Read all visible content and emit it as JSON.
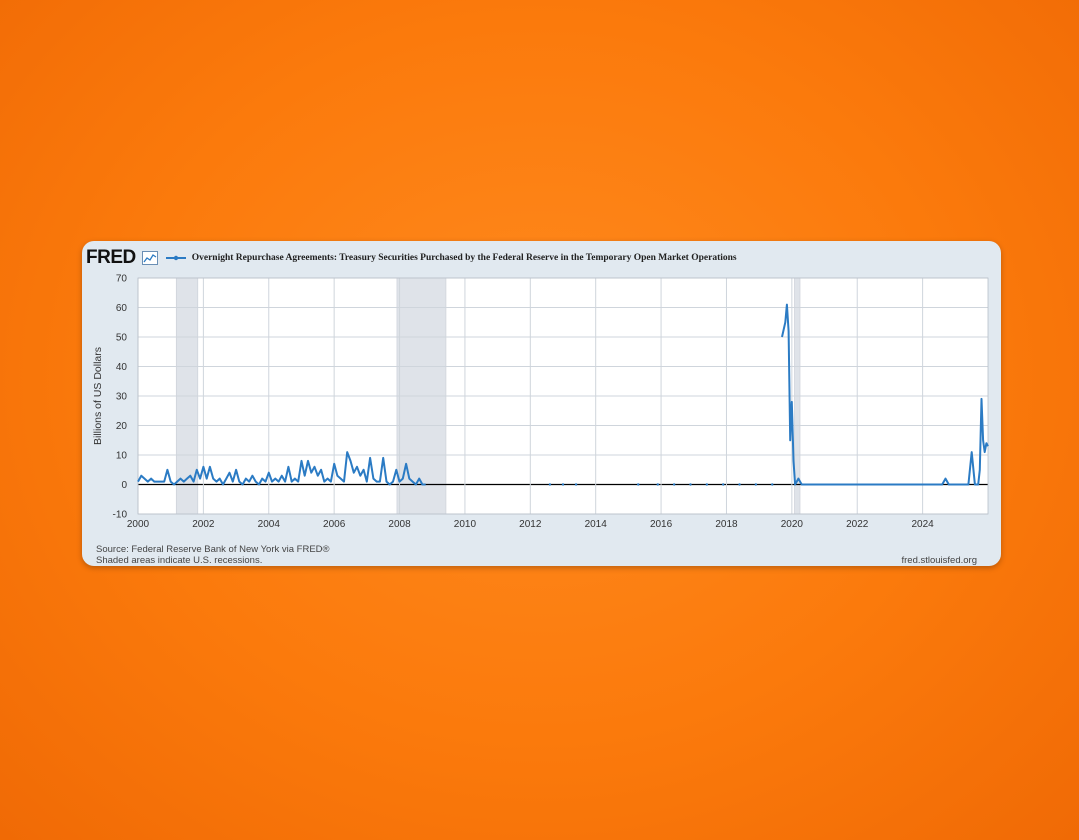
{
  "brand": {
    "logo_text": "FRED"
  },
  "colors": {
    "background": "#fb7a0c",
    "card": "#e1e9f0",
    "line": "#2b7bc4",
    "recession": "#dfe3e9"
  },
  "chart_data": {
    "type": "line",
    "title": "Overnight Repurchase Agreements: Treasury Securities Purchased by the Federal Reserve in the Temporary Open Market Operations",
    "ylabel": "Billions of US Dollars",
    "xlim": [
      2000,
      2026
    ],
    "ylim": [
      -10,
      70
    ],
    "yticks": [
      -10,
      0,
      10,
      20,
      30,
      40,
      50,
      60,
      70
    ],
    "xticks": [
      2000,
      2002,
      2004,
      2006,
      2008,
      2010,
      2012,
      2014,
      2016,
      2018,
      2020,
      2022,
      2024
    ],
    "recessions": [
      [
        2001.17,
        2001.83
      ],
      [
        2007.92,
        2009.42
      ],
      [
        2020.08,
        2020.25
      ]
    ],
    "series": [
      {
        "segments": [
          [
            [
              2000.0,
              1
            ],
            [
              2000.1,
              3
            ],
            [
              2000.2,
              2
            ],
            [
              2000.3,
              1
            ],
            [
              2000.4,
              2
            ],
            [
              2000.5,
              1
            ],
            [
              2000.6,
              1
            ],
            [
              2000.7,
              1
            ],
            [
              2000.8,
              1
            ],
            [
              2000.9,
              5
            ],
            [
              2001.0,
              1
            ],
            [
              2001.1,
              0
            ],
            [
              2001.2,
              1
            ],
            [
              2001.3,
              2
            ],
            [
              2001.4,
              1
            ],
            [
              2001.5,
              2
            ],
            [
              2001.6,
              3
            ],
            [
              2001.7,
              1
            ],
            [
              2001.8,
              5
            ],
            [
              2001.9,
              2
            ],
            [
              2002.0,
              6
            ],
            [
              2002.1,
              2
            ],
            [
              2002.2,
              6
            ],
            [
              2002.3,
              2
            ],
            [
              2002.4,
              1
            ],
            [
              2002.5,
              2
            ],
            [
              2002.6,
              0
            ],
            [
              2002.7,
              2
            ],
            [
              2002.8,
              4
            ],
            [
              2002.9,
              1
            ],
            [
              2003.0,
              5
            ],
            [
              2003.1,
              1
            ],
            [
              2003.2,
              0
            ],
            [
              2003.3,
              2
            ],
            [
              2003.4,
              1
            ],
            [
              2003.5,
              3
            ],
            [
              2003.6,
              1
            ],
            [
              2003.7,
              0
            ],
            [
              2003.8,
              2
            ],
            [
              2003.9,
              1
            ],
            [
              2004.0,
              4
            ],
            [
              2004.1,
              1
            ],
            [
              2004.2,
              2
            ],
            [
              2004.3,
              1
            ],
            [
              2004.4,
              3
            ],
            [
              2004.5,
              1
            ],
            [
              2004.6,
              6
            ],
            [
              2004.7,
              1
            ],
            [
              2004.8,
              2
            ],
            [
              2004.9,
              1
            ],
            [
              2005.0,
              8
            ],
            [
              2005.1,
              3
            ],
            [
              2005.2,
              8
            ],
            [
              2005.3,
              4
            ],
            [
              2005.4,
              6
            ],
            [
              2005.5,
              3
            ],
            [
              2005.6,
              5
            ],
            [
              2005.7,
              1
            ],
            [
              2005.8,
              2
            ],
            [
              2005.9,
              1
            ],
            [
              2006.0,
              7
            ],
            [
              2006.1,
              3
            ],
            [
              2006.2,
              2
            ],
            [
              2006.3,
              1
            ],
            [
              2006.4,
              11
            ],
            [
              2006.5,
              8
            ],
            [
              2006.6,
              4
            ],
            [
              2006.7,
              6
            ],
            [
              2006.8,
              3
            ],
            [
              2006.9,
              5
            ],
            [
              2007.0,
              1
            ],
            [
              2007.1,
              9
            ],
            [
              2007.2,
              2
            ],
            [
              2007.3,
              1
            ],
            [
              2007.4,
              1
            ],
            [
              2007.5,
              9
            ],
            [
              2007.6,
              1
            ],
            [
              2007.7,
              0
            ],
            [
              2007.8,
              1
            ],
            [
              2007.9,
              5
            ],
            [
              2008.0,
              1
            ],
            [
              2008.1,
              2
            ],
            [
              2008.2,
              7
            ],
            [
              2008.3,
              2
            ],
            [
              2008.4,
              1
            ],
            [
              2008.5,
              0
            ],
            [
              2008.6,
              2
            ],
            [
              2008.7,
              0
            ],
            [
              2008.8,
              0
            ]
          ]
        ],
        "points": [
          [
            2012.6,
            0
          ],
          [
            2013.0,
            0
          ],
          [
            2013.4,
            0
          ],
          [
            2015.3,
            0
          ],
          [
            2015.9,
            0
          ],
          [
            2016.4,
            0
          ],
          [
            2016.9,
            0
          ],
          [
            2017.4,
            0
          ],
          [
            2017.9,
            0
          ],
          [
            2018.4,
            0
          ],
          [
            2018.9,
            0
          ],
          [
            2019.4,
            0
          ]
        ],
        "segments2": [
          [
            [
              2019.7,
              50
            ],
            [
              2019.8,
              55
            ],
            [
              2019.85,
              61
            ],
            [
              2019.9,
              52
            ],
            [
              2019.95,
              15
            ],
            [
              2020.0,
              28
            ],
            [
              2020.05,
              8
            ],
            [
              2020.1,
              0
            ],
            [
              2020.2,
              2
            ],
            [
              2020.3,
              0
            ],
            [
              2020.5,
              0
            ],
            [
              2021,
              0
            ],
            [
              2022,
              0
            ],
            [
              2023,
              0
            ],
            [
              2024,
              0
            ],
            [
              2024.6,
              0
            ],
            [
              2024.7,
              2
            ],
            [
              2024.8,
              0
            ],
            [
              2025.0,
              0
            ],
            [
              2025.4,
              0
            ],
            [
              2025.5,
              11
            ],
            [
              2025.6,
              0
            ],
            [
              2025.7,
              0
            ],
            [
              2025.75,
              5
            ],
            [
              2025.8,
              29
            ],
            [
              2025.85,
              15
            ],
            [
              2025.9,
              11
            ],
            [
              2025.95,
              14
            ],
            [
              2026.0,
              13
            ]
          ]
        ]
      }
    ]
  },
  "footer": {
    "source": "Source: Federal Reserve Bank of New York via FRED®",
    "note": "Shaded areas indicate U.S. recessions.",
    "url": "fred.stlouisfed.org"
  }
}
